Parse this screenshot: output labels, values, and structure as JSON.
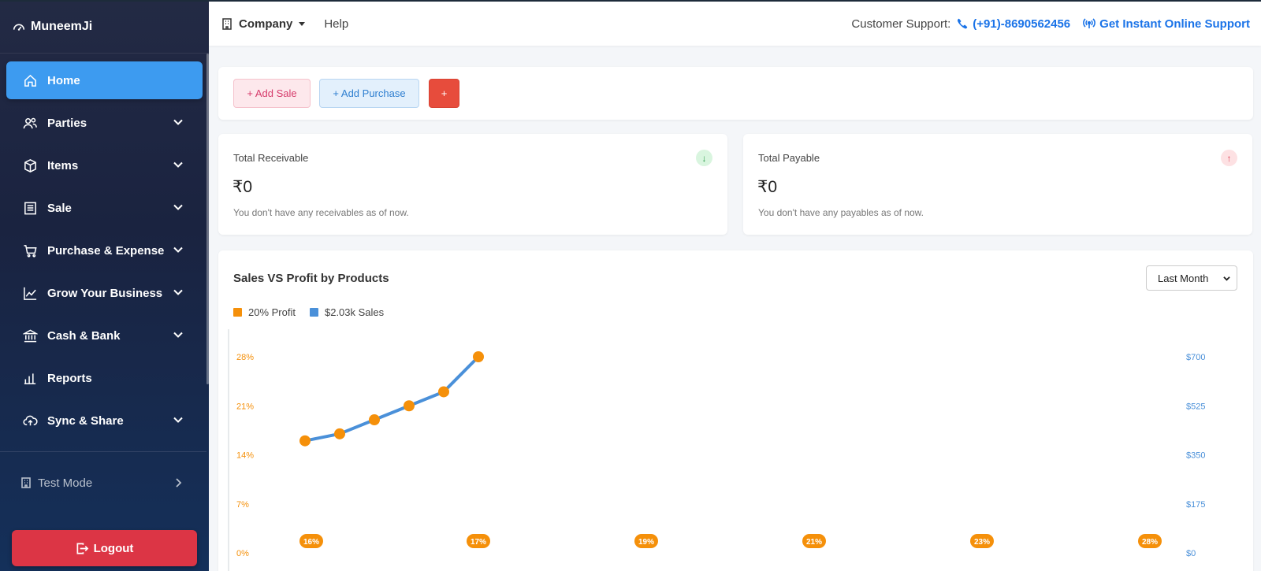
{
  "app": {
    "brand": "MuneemJi"
  },
  "sidebar": {
    "items": [
      {
        "label": "Home",
        "icon": "home-icon",
        "active": true,
        "expandable": false
      },
      {
        "label": "Parties",
        "icon": "users-icon",
        "active": false,
        "expandable": true
      },
      {
        "label": "Items",
        "icon": "box-icon",
        "active": false,
        "expandable": true
      },
      {
        "label": "Sale",
        "icon": "receipt-icon",
        "active": false,
        "expandable": true
      },
      {
        "label": "Purchase & Expense",
        "icon": "cart-icon",
        "active": false,
        "expandable": true
      },
      {
        "label": "Grow Your Business",
        "icon": "trend-icon",
        "active": false,
        "expandable": true
      },
      {
        "label": "Cash & Bank",
        "icon": "bank-icon",
        "active": false,
        "expandable": true
      },
      {
        "label": "Reports",
        "icon": "bar-chart-icon",
        "active": false,
        "expandable": false
      },
      {
        "label": "Sync & Share",
        "icon": "cloud-upload-icon",
        "active": false,
        "expandable": true
      }
    ],
    "test_mode": "Test Mode",
    "logout": "Logout"
  },
  "topbar": {
    "company": "Company",
    "help": "Help",
    "support_label": "Customer Support:",
    "phone": "(+91)-8690562456",
    "instant_support": "Get Instant Online Support"
  },
  "actions": {
    "add_sale": "+ Add Sale",
    "add_purchase": "+ Add Purchase",
    "more": "+"
  },
  "receivable": {
    "title": "Total Receivable",
    "amount": "₹0",
    "note": "You don't have any receivables as of now.",
    "badge": "↓"
  },
  "payable": {
    "title": "Total Payable",
    "amount": "₹0",
    "note": "You don't have any payables as of now.",
    "badge": "↑"
  },
  "chart_panel": {
    "period": "Last Month"
  },
  "colors": {
    "accent": "#3d9bf0",
    "profit": "#f5900a",
    "sales": "#4a90d9",
    "danger": "#dc3545"
  },
  "chart_data": {
    "type": "line",
    "title": "Sales VS Profit by Products",
    "legend": [
      {
        "name": "20% Profit",
        "color": "#f5900a"
      },
      {
        "name": "$2.03k Sales",
        "color": "#4a90d9"
      }
    ],
    "y_left_ticks": [
      "28%",
      "21%",
      "14%",
      "7%",
      "0%"
    ],
    "y_left_range": [
      0,
      28
    ],
    "y_right_ticks": [
      "$700",
      "$525",
      "$350",
      "$175",
      "$0"
    ],
    "y_right_range": [
      0,
      700
    ],
    "x_badges": [
      "16%",
      "17%",
      "19%",
      "21%",
      "23%",
      "28%"
    ],
    "series": [
      {
        "values": [
          16,
          17,
          19,
          21,
          23,
          28
        ]
      }
    ]
  }
}
